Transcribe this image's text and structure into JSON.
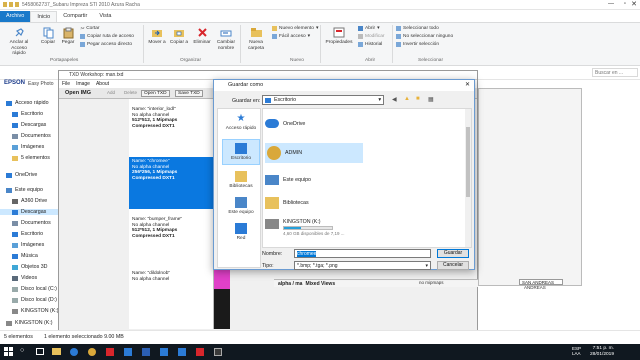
{
  "window": {
    "title": "5458062737_Subaru Impreza STI 2010 Azura Racha"
  },
  "tabs": [
    "Archivo",
    "Inicio",
    "Compartir",
    "Vista"
  ],
  "ribbon": {
    "anclar": "Anclar al Acceso rápido",
    "copiar": "Copiar",
    "pegar": "Pegar",
    "cortar": "Cortar",
    "copiar_ruta": "Copiar ruta de acceso",
    "pegar_acceso": "Pegar acceso directo",
    "mover": "Mover a",
    "copiar_a": "Copiar a",
    "eliminar": "Eliminar",
    "cambiar_nombre": "Cambiar nombre",
    "nueva_carpeta": "Nueva carpeta",
    "nuevo_elemento": "Nuevo elemento",
    "facil_acceso": "Fácil acceso",
    "propiedades": "Propiedades",
    "abrir": "Abrir",
    "modificar": "Modificar",
    "historial": "Historial",
    "sel_todo": "Seleccionar todo",
    "no_sel": "No seleccionar ninguno",
    "invertir": "Invertir selección",
    "groups": {
      "portapapeles": "Portapapeles",
      "organizar": "Organizar",
      "nuevo": "Nuevo",
      "abrir": "Abrir",
      "seleccionar": "Seleccionar"
    }
  },
  "search": {
    "placeholder": "Buscar en ..."
  },
  "nav": {
    "items": [
      "Acceso rápido",
      "Escritorio",
      "Descargas",
      "Documentos",
      "Imágenes",
      "5 elementos",
      "OneDrive",
      "Este equipo",
      "A360 Drive",
      "Descargas",
      "Documentos",
      "Escritorio",
      "Imágenes",
      "Música",
      "Objetos 3D",
      "Videos",
      "Disco local (C:)",
      "Disco local (D:)",
      "KINGSTON (K:)",
      "KINGSTON (K:)"
    ]
  },
  "bg_app": {
    "title": "TXD Workshop: man.txd",
    "epson": "EPSON",
    "epson2": "Easy Photo",
    "menu": [
      "File",
      "Image",
      "About"
    ],
    "toolbar": [
      "Open IMG",
      "Open TXD",
      "Save TXD"
    ],
    "tb_extra": [
      "Add",
      "Delete"
    ],
    "textures": [
      {
        "name": "Name: \"interior_lodl\"",
        "alpha": "No alpha channel",
        "size": "512*512, 1 Mipmaps",
        "comp": "Compressed DXT1"
      },
      {
        "name": "Name: \"chromee\"",
        "alpha": "No alpha channel",
        "size": "256*256, 1 Mipmaps",
        "comp": "Compressed DXT1"
      },
      {
        "name": "Name: \"bumper_frame\"",
        "alpha": "No alpha channel",
        "size": "512*512, 1 Mipmaps",
        "comp": "Compressed DXT1"
      },
      {
        "name": "Name: \"dildolnob\"",
        "alpha": "No alpha channel",
        "size": "",
        "comp": ""
      }
    ],
    "bottom_left": "alpha / ma",
    "bottom_mid": "Mixed Views",
    "no_mipmaps": "no mipmaps",
    "san_andreas": "SAN ANDREAS"
  },
  "status": {
    "count": "5 elementos",
    "selected": "1 elemento seleccionado 9.00 MB"
  },
  "dialog": {
    "title": "Guardar como",
    "guardar_en_label": "Guardar en:",
    "guardar_en_value": "Escritorio",
    "places": [
      "Acceso rápido",
      "Escritorio",
      "Bibliotecas",
      "Este equipo",
      "Red"
    ],
    "files": [
      {
        "name": "OneDrive",
        "sub": ""
      },
      {
        "name": "ADMIN",
        "sub": ""
      },
      {
        "name": "Este equipo",
        "sub": ""
      },
      {
        "name": "Bibliotecas",
        "sub": ""
      },
      {
        "name": "KINGSTON (K:)",
        "sub": "4,60 GB disponibles de 7,19 ..."
      }
    ],
    "nombre_label": "Nombre:",
    "nombre_value": "chromee",
    "tipo_label": "Tipo:",
    "tipo_value": "*.bmp; *.tga; *.png",
    "guardar": "Guardar",
    "cancelar": "Cancelar"
  },
  "taskbar": {
    "lang": "ESP",
    "lang2": "LAA",
    "time": "7:51 p. m.",
    "date": "28/01/2019"
  },
  "colors": {
    "accent": "#1979ca",
    "select": "#cce8ff",
    "taskbar": "#101820"
  }
}
